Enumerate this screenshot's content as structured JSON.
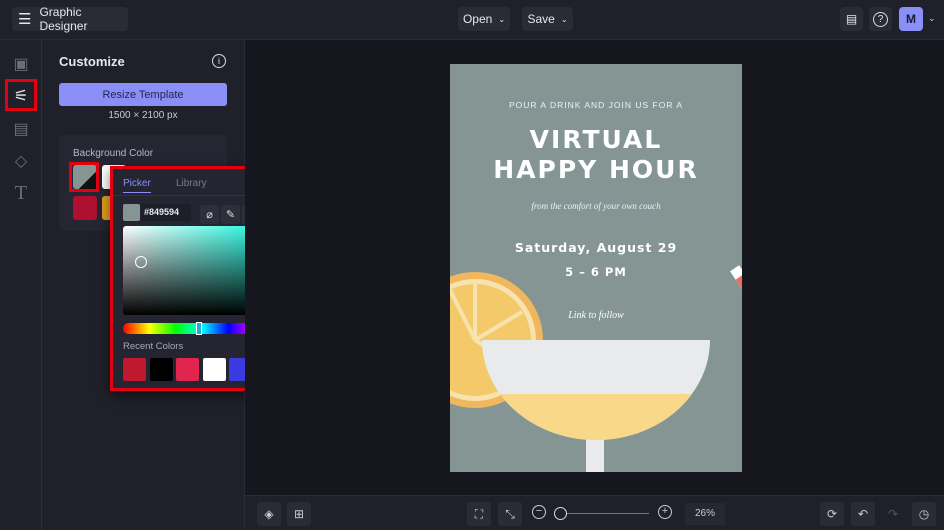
{
  "header": {
    "app_title": "Graphic Designer",
    "open_label": "Open",
    "save_label": "Save",
    "avatar_initial": "M"
  },
  "panel": {
    "title": "Customize",
    "resize_label": "Resize Template",
    "dimensions": "1500 × 2100 px",
    "background_label": "Background Color",
    "swatches": [
      "#849594",
      "#ffffff",
      "#b01030",
      "#e0a020"
    ]
  },
  "picker": {
    "tab_picker": "Picker",
    "tab_library": "Library",
    "hex": "#849594",
    "recent_label": "Recent Colors",
    "recent": [
      "#c0182e",
      "#000000",
      "#e0264e",
      "#ffffff",
      "#3a3ae0",
      "#1f2029"
    ]
  },
  "poster": {
    "bg": "#849594",
    "line1": "POUR A DRINK AND JOIN US FOR A",
    "title1": "VIRTUAL",
    "title2": "HAPPY HOUR",
    "script1": "from the comfort of your own couch",
    "date": "Saturday, August 29",
    "time": "5 – 6 PM",
    "link": "Link to follow"
  },
  "zoom": {
    "value": "26%",
    "level": 0.03
  }
}
